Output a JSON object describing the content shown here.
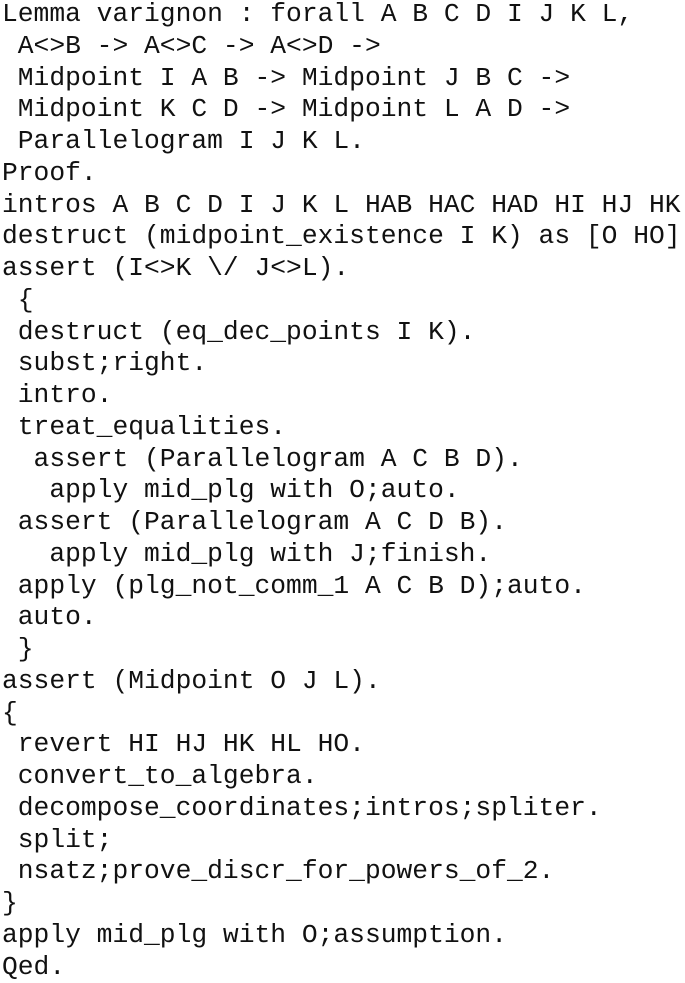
{
  "document": {
    "language": "Coq",
    "lines": [
      "Lemma varignon : forall A B C D I J K L,",
      " A<>B -> A<>C -> A<>D ->",
      " Midpoint I A B -> Midpoint J B C ->",
      " Midpoint K C D -> Midpoint L A D ->",
      " Parallelogram I J K L.",
      "Proof.",
      "intros A B C D I J K L HAB HAC HAD HI HJ HK HL.",
      "destruct (midpoint_existence I K) as [O HO].",
      "assert (I<>K \\/ J<>L).",
      " {",
      " destruct (eq_dec_points I K).",
      " subst;right.",
      " intro.",
      " treat_equalities.",
      "  assert (Parallelogram A C B D).",
      "   apply mid_plg with O;auto.",
      " assert (Parallelogram A C D B).",
      "   apply mid_plg with J;finish.",
      " apply (plg_not_comm_1 A C B D);auto.",
      " auto.",
      " }",
      "assert (Midpoint O J L).",
      "{",
      " revert HI HJ HK HL HO.",
      " convert_to_algebra.",
      " decompose_coordinates;intros;spliter.",
      " split;",
      " nsatz;prove_discr_for_powers_of_2.",
      "}",
      "apply mid_plg with O;assumption.",
      "Qed."
    ]
  }
}
